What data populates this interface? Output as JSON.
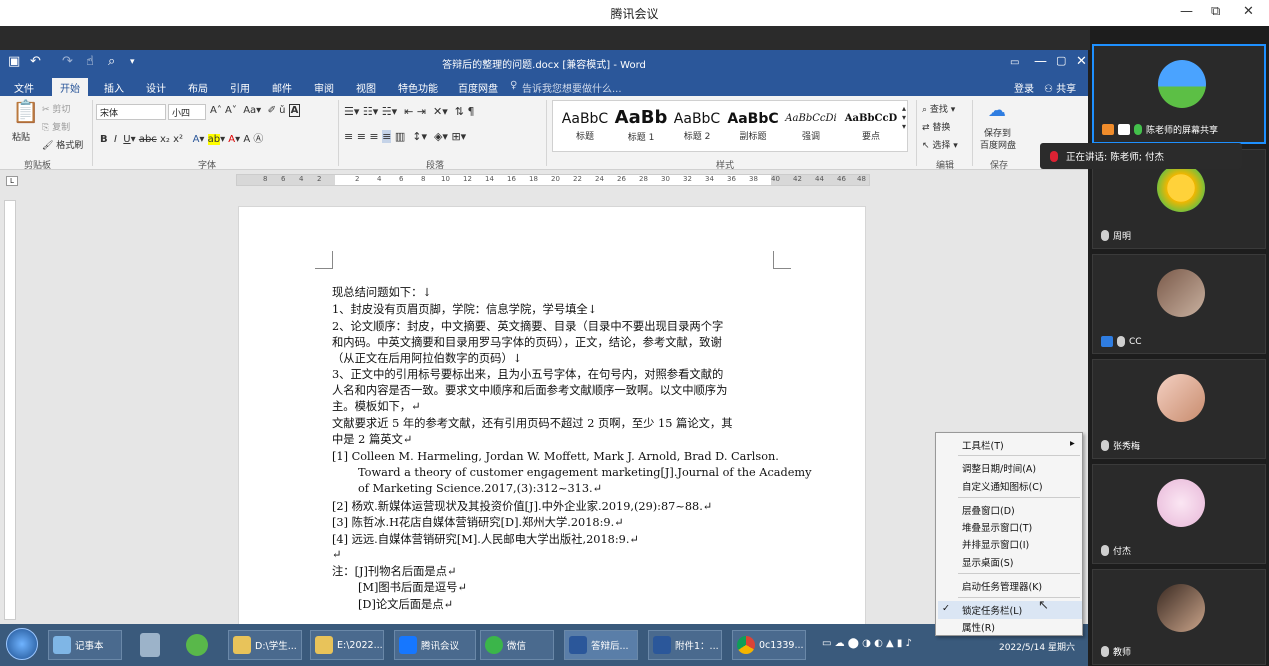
{
  "app": {
    "title": "腾讯会议",
    "window_controls": [
      "—",
      "⧉",
      "✕"
    ]
  },
  "word": {
    "doc_title": "答辩后的整理的问题.docx [兼容模式] - Word",
    "tabs": [
      "文件",
      "开始",
      "插入",
      "设计",
      "布局",
      "引用",
      "邮件",
      "审阅",
      "视图",
      "特色功能",
      "百度网盘"
    ],
    "tell_me": "告诉我您想要做什么...",
    "login": "登录",
    "share": "共享",
    "clipboard": {
      "paste": "粘贴",
      "cut": "剪切",
      "copy": "复制",
      "format_painter": "格式刷",
      "group": "剪贴板"
    },
    "font": {
      "name": "宋体",
      "size": "小四",
      "group": "字体"
    },
    "paragraph_group": "段落",
    "styles": [
      {
        "sample": "AaBbC",
        "name": "标题"
      },
      {
        "sample": "AaBb",
        "name": "标题 1"
      },
      {
        "sample": "AaBbC",
        "name": "标题 2"
      },
      {
        "sample": "AaBbC",
        "name": "副标题"
      },
      {
        "sample": "AaBbCcDi",
        "name": "强调"
      },
      {
        "sample": "AaBbCcD",
        "name": "要点"
      }
    ],
    "styles_group": "样式",
    "editing": {
      "find": "查找",
      "replace": "替换",
      "select": "选择",
      "group": "编辑"
    },
    "save": {
      "label1": "保存到",
      "label2": "百度网盘",
      "group": "保存"
    },
    "ruler_numbers": [
      "8",
      "6",
      "4",
      "2",
      "",
      "2",
      "4",
      "6",
      "8",
      "10",
      "12",
      "14",
      "16",
      "18",
      "20",
      "22",
      "24",
      "26",
      "28",
      "30",
      "32",
      "34",
      "36",
      "38",
      "40",
      "42",
      "44",
      "46",
      "48"
    ],
    "doc_lines": [
      "现总结问题如下：↓",
      "1、封皮没有页眉页脚，学院：信息学院，学号填全↓",
      "2、论文顺序：封皮，中文摘要、英文摘要、目录（目录中不要出现目录两个字",
      "和内码。中英文摘要和目录用罗马字体的页码），正文，结论，参考文献，致谢",
      "（从正文在后用阿拉伯数字的页码）↓",
      "3、正文中的引用标号要标出来，且为小五号字体，在句号内，对照参看文献的",
      "人名和内容是否一致。要求文中顺序和后面参考文献顺序一致啊。以文中顺序为",
      "主。模板如下，↵",
      "文献要求近 5 年的参考文献，还有引用页码不超过 2 页啊，至少 15 篇论文，其",
      "中是 2 篇英文↵",
      "[1]  Colleen M. Harmeling, Jordan W. Moffett, Mark J. Arnold, Brad D. Carlson.",
      "Toward a theory of customer engagement marketing[J].Journal of the Academy",
      "of Marketing Science.2017,(3):312~313.↵",
      "[2]  杨欢.新媒体运营现状及其投资价值[J].中外企业家.2019,(29):87~88.↵",
      "[3]  陈哲冰.H花店自媒体营销研究[D].郑州大学.2018:9.↵",
      "[4]  远远.自媒体营销研究[M].人民邮电大学出版社,2018:9.↵",
      "↵",
      "注：[J]刊物名后面是点↵",
      "[M]图书后面是逗号↵",
      "[D]论文后面是点↵"
    ]
  },
  "context_menu": {
    "items": [
      "工具栏(T)",
      "调整日期/时间(A)",
      "自定义通知图标(C)",
      "层叠窗口(D)",
      "堆叠显示窗口(T)",
      "并排显示窗口(I)",
      "显示桌面(S)",
      "启动任务管理器(K)",
      "锁定任务栏(L)",
      "属性(R)"
    ],
    "submenu_arrow": "▸",
    "check": "✓"
  },
  "taskbar": {
    "items": [
      "记事本",
      "D:\\学生...",
      "E:\\2022...",
      "腾讯会议",
      "微信",
      "答辩后...",
      "附件1：...",
      "0c1339..."
    ],
    "date": "2022/5/14 星期六"
  },
  "meeting": {
    "speaking": "正在讲话: 陈老师; 付杰",
    "participants": [
      "陈老师的屏幕共享",
      "周明",
      "CC",
      "张秀梅",
      "付杰",
      "教师"
    ]
  }
}
